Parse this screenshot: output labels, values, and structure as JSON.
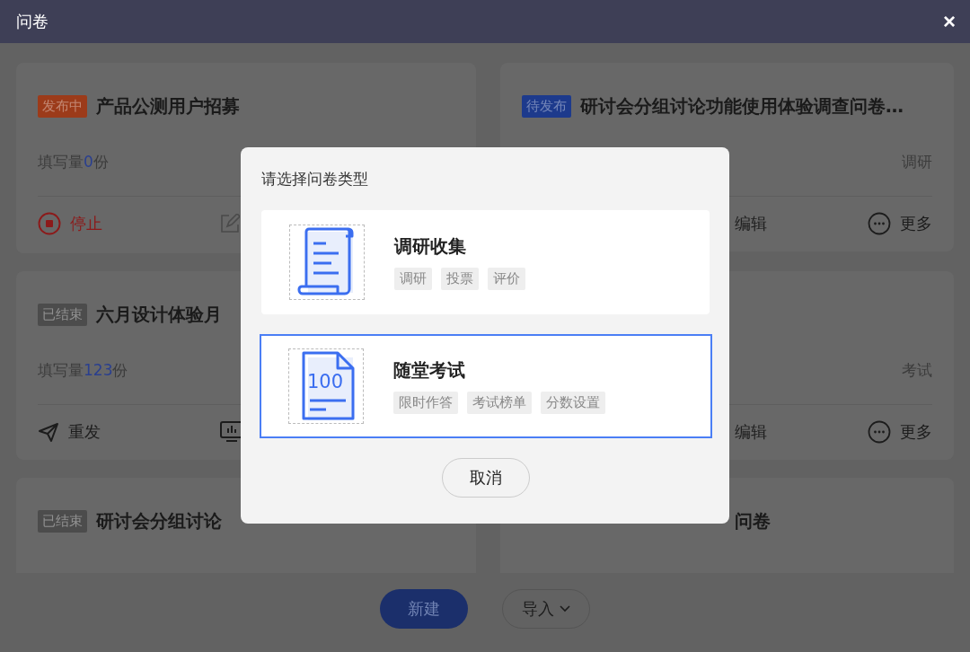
{
  "window": {
    "title": "问卷",
    "close": "×"
  },
  "cards": [
    {
      "tag": {
        "label": "发布中",
        "color": "#9c3b1a"
      },
      "title": "产品公测用户招募",
      "count": {
        "prefix": "填写量",
        "value": "0",
        "suffix": "份"
      },
      "actions": {
        "left": {
          "kind": "stop",
          "label": "停止"
        },
        "middle": {
          "kind": "edit"
        }
      }
    },
    {
      "tag": {
        "label": "待发布",
        "color": "#1d3a8c"
      },
      "title": "研讨会分组讨论功能使用体验调查问卷…",
      "type": "调研",
      "actions": {
        "middle": {
          "kind": "text",
          "label": "编辑"
        },
        "right": {
          "kind": "more",
          "label": "更多"
        }
      }
    },
    {
      "tag": {
        "label": "已结束",
        "color": "#4c4c4c"
      },
      "title": "六月设计体验月",
      "count": {
        "prefix": "填写量",
        "value": "123",
        "suffix": "份"
      },
      "actions": {
        "left": {
          "kind": "send",
          "label": "重发"
        },
        "middle": {
          "kind": "stats"
        }
      }
    },
    {
      "type": "考试",
      "actions": {
        "middle": {
          "kind": "text",
          "label": "编辑"
        },
        "right": {
          "kind": "more",
          "label": "更多"
        }
      }
    },
    {
      "tag": {
        "label": "已结束",
        "color": "#4c4c4c"
      },
      "title": "研讨会分组讨论"
    },
    {
      "title": "问卷"
    }
  ],
  "footer": {
    "create": "新建",
    "import": "导入"
  },
  "dialog": {
    "title": "请选择问卷类型",
    "options": [
      {
        "kind": "scroll",
        "title": "调研收集",
        "selected": false,
        "tags": [
          "调研",
          "投票",
          "评价"
        ]
      },
      {
        "kind": "exam",
        "icon_text": "100",
        "title": "随堂考试",
        "selected": true,
        "tags": [
          "限时作答",
          "考试榜单",
          "分数设置"
        ]
      }
    ],
    "cancel": "取消"
  }
}
